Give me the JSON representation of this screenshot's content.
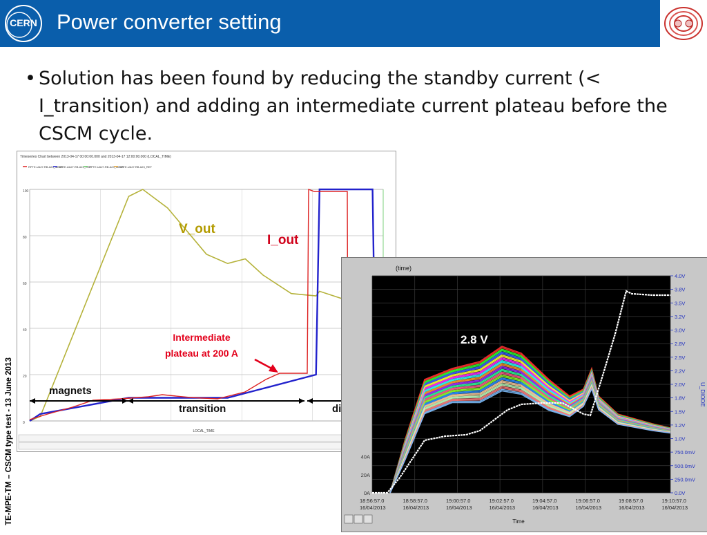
{
  "slide": {
    "title": "Power converter setting",
    "bullet": "Solution has been found by reducing the standby current (< I_transition) and adding an intermediate current plateau before the CSCM cycle.",
    "side_label": "TE-MPE-TM – CSCM type test - 13 June 2013",
    "logo_left_text": "CERN",
    "colors": {
      "header": "#0a5eab",
      "annotation_red": "#e3001b",
      "vout_olive": "#b39b00"
    }
  },
  "left_chart": {
    "header_text": "Timeseries Chart between 2013-04-17 00:00:00.000 and 2013-04-17 12:00:00.000 (LOCAL_TIME)",
    "legend": [
      "RPTE.UA27.RB.A23_MEAS",
      "RPTE.UA27.RB.A23_REF",
      "RPTE.UA27.RB.A23_MEAS",
      "RPTE.UA27.RB.A23_REF"
    ],
    "ytick_labels": [
      "100",
      "80",
      "60",
      "40",
      "20",
      "0"
    ],
    "xaxis_label": "LOCAL_TIME",
    "labels": {
      "v_out": "V_out",
      "i_out": "I_out",
      "plateau": "Intermediate plateau at 200 A",
      "magnets": "magnets",
      "transition": "transition",
      "diodes": "diodes"
    },
    "chart_data": {
      "type": "line",
      "series": [
        {
          "name": "V_out",
          "color": "#b5b23a",
          "x": [
            0,
            0.03,
            0.28,
            0.32,
            0.39,
            0.5,
            0.56,
            0.61,
            0.66,
            0.74,
            0.81,
            0.82,
            0.9,
            0.97
          ],
          "y": [
            0,
            2,
            97,
            100,
            92,
            72,
            68,
            70,
            63,
            55,
            54,
            56,
            52,
            51
          ]
        },
        {
          "name": "I_out",
          "color": "#2222cc",
          "x": [
            0,
            0.03,
            0.28,
            0.32,
            0.56,
            0.81,
            0.82,
            0.97,
            0.98
          ],
          "y": [
            0,
            3,
            10,
            10,
            10,
            20,
            100,
            100,
            0
          ]
        }
      ]
    }
  },
  "right_scope": {
    "title": "(time)",
    "value_label": "2.8 V",
    "right_axis_name": "U_DIODE",
    "left_ticks": [
      "40A",
      "20A",
      "0A"
    ],
    "right_ticks": [
      "4.0V",
      "3.8V",
      "3.5V",
      "3.2V",
      "3.0V",
      "2.8V",
      "2.5V",
      "2.2V",
      "2.0V",
      "1.8V",
      "1.5V",
      "1.2V",
      "1.0V",
      "750.0mV",
      "500.0mV",
      "250.0mV",
      "0.0V"
    ],
    "x_ticks": [
      {
        "time": "18:56:57.0",
        "date": "16/04/2013"
      },
      {
        "time": "18:58:57.0",
        "date": "16/04/2013"
      },
      {
        "time": "19:00:57.0",
        "date": "16/04/2013"
      },
      {
        "time": "19:02:57.0",
        "date": "16/04/2013"
      },
      {
        "time": "19:04:57.0",
        "date": "16/04/2013"
      },
      {
        "time": "19:06:57.0",
        "date": "16/04/2013"
      },
      {
        "time": "19:08:57.0",
        "date": "16/04/2013"
      },
      {
        "time": "19:10:57.0",
        "date": "16/04/2013"
      }
    ],
    "x_axis_label": "Time"
  }
}
